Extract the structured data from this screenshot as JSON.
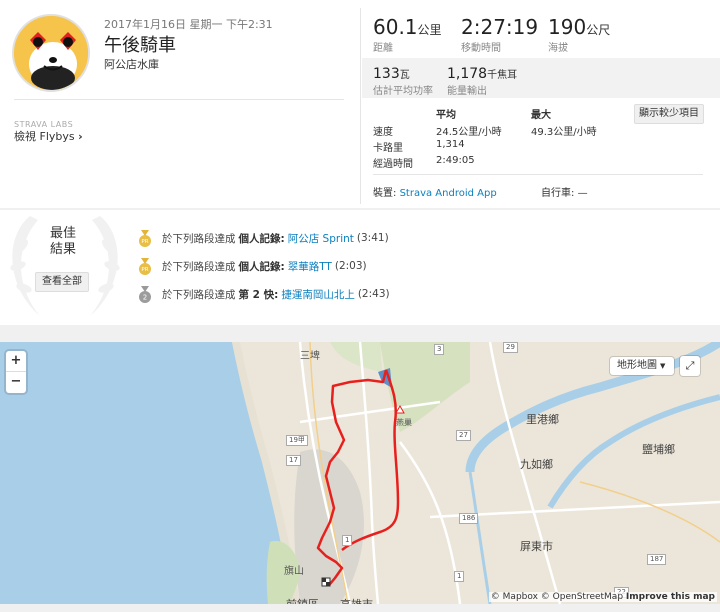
{
  "activity": {
    "date": "2017年1月16日 星期一 下午2:31",
    "title": "午後騎車",
    "description": "阿公店水庫",
    "labs": "STRAVA LABS",
    "flybys_prefix": "檢視",
    "flybys_name": "Flybys",
    "flybys_chevron": "›"
  },
  "stats": {
    "distance": {
      "value": "60.1",
      "unit": "公里",
      "label": "距離"
    },
    "moving_time": {
      "value": "2:27:19",
      "label": "移動時間"
    },
    "elevation": {
      "value": "190",
      "unit": "公尺",
      "label": "海拔"
    },
    "power": {
      "value": "133",
      "unit": "瓦",
      "label": "估計平均功率"
    },
    "energy": {
      "value": "1,178",
      "unit": "千焦耳",
      "label": "能量輸出"
    }
  },
  "more_stats": {
    "col_avg": "平均",
    "col_max": "最大",
    "show_less": "顯示較少項目",
    "rows": [
      {
        "label": "速度",
        "avg": "24.5公里/小時",
        "max": "49.3公里/小時"
      },
      {
        "label": "卡路里",
        "avg": "1,314",
        "max": ""
      },
      {
        "label": "經過時間",
        "avg": "2:49:05",
        "max": ""
      }
    ],
    "device_label": "裝置:",
    "device_value": "Strava Android App",
    "bike_label": "自行車:",
    "bike_value": "—"
  },
  "best": {
    "title": "最佳結果",
    "title_line1": "最佳",
    "title_line2": "結果",
    "see_all": "查看全部",
    "achievements": [
      {
        "prefix": "於下列路段達成",
        "rank": "個人記錄:",
        "segment": "阿公店 Sprint",
        "time": "(3:41)",
        "medal": "pr"
      },
      {
        "prefix": "於下列路段達成",
        "rank": "個人記錄:",
        "segment": "翠華路TT",
        "time": "(2:03)",
        "medal": "pr"
      },
      {
        "prefix": "於下列路段達成",
        "rank": "第 2 快:",
        "segment": "捷運南岡山北上",
        "time": "(2:43)",
        "medal": "2"
      }
    ],
    "medal_pr_text": "PR",
    "medal_2_text": "2"
  },
  "map": {
    "zoom_in": "+",
    "zoom_out": "−",
    "map_type": "地形地圖",
    "expand_icon": "expand-icon",
    "attribution_mapbox": "© Mapbox",
    "attribution_osm": "© OpenStreetMap",
    "attribution_improve": "Improve this map",
    "places": [
      "三埤",
      "里港鄉",
      "鹽埔鄉",
      "九如鄉",
      "屏東市",
      "旗山",
      "燕巢",
      "高雄市",
      "前鎮區"
    ],
    "roads": [
      "19甲",
      "17",
      "1",
      "186",
      "27",
      "29",
      "3",
      "187",
      "1",
      "22"
    ],
    "route_color": "#e8201d",
    "water_color": "#a9cfe8"
  }
}
